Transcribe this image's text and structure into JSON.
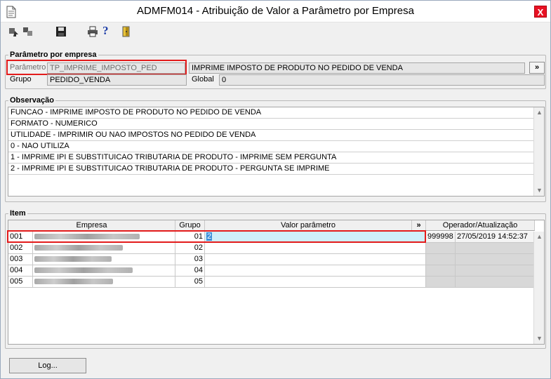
{
  "window": {
    "title": "ADMFM014 - Atribuição de Valor a Parâmetro por Empresa",
    "close_label": "X"
  },
  "toolbar": {
    "icons": [
      "first-record-icon",
      "next-record-icon",
      "save-icon",
      "print-icon",
      "help-icon",
      "exit-icon"
    ],
    "help_glyph": "?"
  },
  "parametro_empresa": {
    "legend": "Parâmetro por empresa",
    "parametro_label": "Parâmetro",
    "parametro_value": "TP_IMPRIME_IMPOSTO_PED",
    "descricao_value": "IMPRIME IMPOSTO DE PRODUTO NO PEDIDO DE VENDA",
    "more_button": "»",
    "grupo_label": "Grupo",
    "grupo_value": "PEDIDO_VENDA",
    "global_label": "Global",
    "global_value": "0"
  },
  "observacao": {
    "legend": "Observação",
    "lines": [
      "FUNCAO - IMPRIME IMPOSTO DE PRODUTO NO PEDIDO DE VENDA",
      "FORMATO - NUMERICO",
      "UTILIDADE - IMPRIMIR OU NAO IMPOSTOS NO PEDIDO DE VENDA",
      "0 - NAO UTILIZA",
      "1 - IMPRIME IPI E SUBSTITUICAO TRIBUTARIA DE PRODUTO - IMPRIME SEM PERGUNTA",
      "2 - IMPRIME IPI E SUBSTITUICAO TRIBUTARIA DE PRODUTO - PERGUNTA SE IMPRIME"
    ]
  },
  "item": {
    "legend": "Item",
    "columns": {
      "empresa": "Empresa",
      "grupo": "Grupo",
      "valor": "Valor parâmetro",
      "expand": "»",
      "operador": "Operador/Atualização"
    },
    "rows": [
      {
        "codigo": "001",
        "grupo": "01",
        "valor": "2",
        "operador": "999998",
        "atualizacao": "27/05/2019 14:52:37"
      },
      {
        "codigo": "002",
        "grupo": "02",
        "valor": "",
        "operador": "",
        "atualizacao": ""
      },
      {
        "codigo": "003",
        "grupo": "03",
        "valor": "",
        "operador": "",
        "atualizacao": ""
      },
      {
        "codigo": "004",
        "grupo": "04",
        "valor": "",
        "operador": "",
        "atualizacao": ""
      },
      {
        "codigo": "005",
        "grupo": "05",
        "valor": "",
        "operador": "",
        "atualizacao": ""
      }
    ]
  },
  "footer": {
    "log_button": "Log..."
  },
  "colors": {
    "highlight_border": "#e31b1b",
    "selected_row": "#cfeffa",
    "close_button": "#e81123"
  }
}
